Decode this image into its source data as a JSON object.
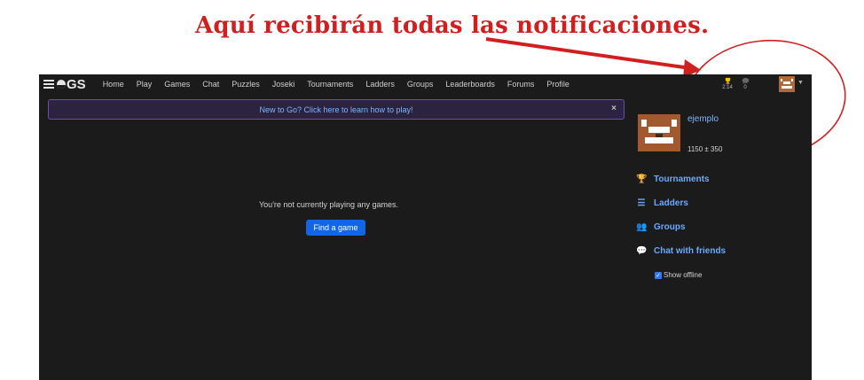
{
  "annotation": {
    "text": "Aquí recibirán todas las notificaciones."
  },
  "topbar": {
    "logo_text": "GS",
    "nav": [
      "Home",
      "Play",
      "Games",
      "Chat",
      "Puzzles",
      "Joseki",
      "Tournaments",
      "Ladders",
      "Groups",
      "Leaderboards",
      "Forums",
      "Profile"
    ],
    "notifications": {
      "trophy_count": "2:14",
      "chat_count": "0"
    }
  },
  "banner": {
    "text": "New to Go? Click here to learn how to play!",
    "close": "×"
  },
  "main": {
    "no_games_text": "You're not currently playing any games.",
    "find_game_label": "Find a game"
  },
  "sidebar": {
    "username": "ejemplo",
    "rating": "1150 ± 350",
    "links": [
      "Tournaments",
      "Ladders",
      "Groups",
      "Chat with friends"
    ],
    "show_offline_label": "Show offline"
  },
  "colors": {
    "annotation": "#d11f1f",
    "link": "#6aa9ff",
    "button": "#1266e6",
    "background": "#1b1b1c"
  }
}
